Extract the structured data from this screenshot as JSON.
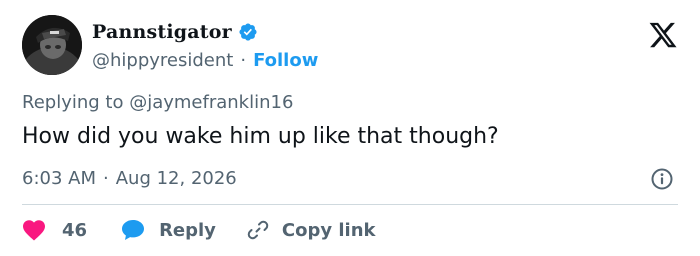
{
  "author": {
    "display_name": "Pannstigator",
    "handle": "@hippyresident",
    "separator": "·",
    "follow_label": "Follow",
    "verified": true
  },
  "reply_context": {
    "prefix": "Replying to",
    "mention": "@jaymefranklin16"
  },
  "tweet": {
    "text": "How did you wake him up like that though?",
    "time": "6:03 AM",
    "separator": "·",
    "date": "Aug 12, 2026"
  },
  "actions": {
    "like_count": "46",
    "reply_label": "Reply",
    "copy_link_label": "Copy link"
  },
  "icons": {
    "verified": "verified-badge-icon",
    "logo": "x-logo-icon",
    "info": "info-icon",
    "like": "heart-icon",
    "reply": "speech-bubble-icon",
    "copy": "link-icon"
  },
  "colors": {
    "accent": "#1d9bf0",
    "like": "#f91880",
    "text_primary": "#0f1419",
    "text_secondary": "#536471",
    "divider": "#cfd9de"
  }
}
